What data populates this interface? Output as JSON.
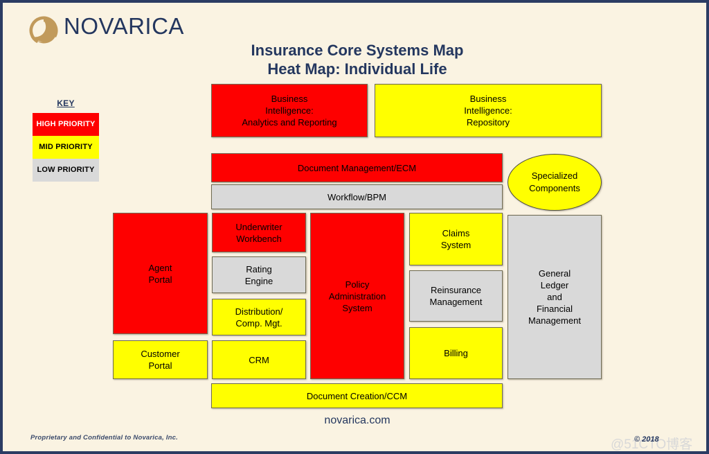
{
  "brand": {
    "name": "NOVARICA",
    "logo_color": "#c19a5b",
    "text_color": "#24375f"
  },
  "title": {
    "line1": "Insurance Core Systems Map",
    "line2": "Heat Map: Individual Life"
  },
  "key": {
    "heading": "KEY",
    "items": [
      {
        "label": "HIGH PRIORITY",
        "color": "#fe0000",
        "text_color": "#ffffff"
      },
      {
        "label": "MID PRIORITY",
        "color": "#ffff00",
        "text_color": "#000000"
      },
      {
        "label": "LOW PRIORITY",
        "color": "#d9d9d9",
        "text_color": "#000000"
      }
    ]
  },
  "boxes": {
    "bi_analytics": "Business\nIntelligence:\nAnalytics and Reporting",
    "bi_repository": "Business\nIntelligence:\nRepository",
    "document_management": "Document Management/ECM",
    "workflow": "Workflow/BPM",
    "specialized": "Specialized\nComponents",
    "agent_portal": "Agent\nPortal",
    "customer_portal": "Customer\nPortal",
    "underwriter_workbench": "Underwriter\nWorkbench",
    "rating_engine": "Rating\nEngine",
    "distribution": "Distribution/\nComp. Mgt.",
    "crm": "CRM",
    "policy_admin": "Policy\nAdministration\nSystem",
    "claims_system": "Claims\nSystem",
    "reinsurance": "Reinsurance\nManagement",
    "billing": "Billing",
    "general_ledger": "General\nLedger\nand\nFinancial\nManagement",
    "document_creation": "Document Creation/CCM"
  },
  "footer": {
    "site": "novarica.com",
    "confidential": "Proprietary and Confidential to Novarica, Inc.",
    "copyright": "© 2018",
    "watermark": "@51CTO博客"
  },
  "palette": {
    "background": "#faf3e2",
    "page_border": "#2b3c63",
    "high": "#fe0000",
    "mid": "#ffff00",
    "low": "#d9d9d9"
  }
}
